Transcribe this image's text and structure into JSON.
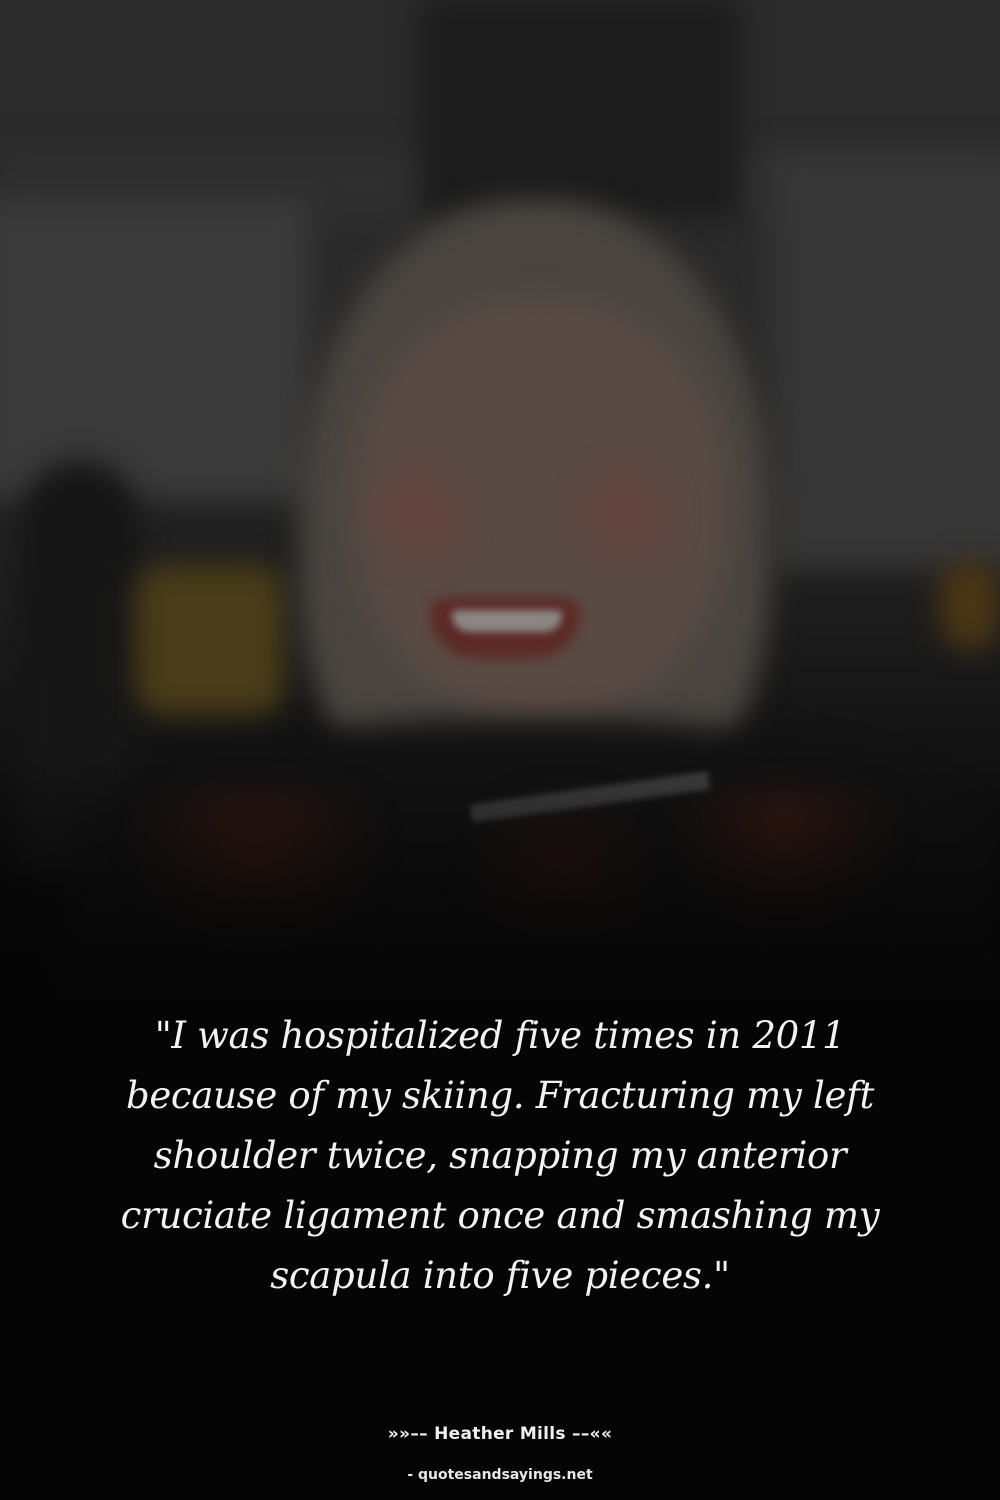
{
  "quote": {
    "text": "\"I was hospitalized five times in 2011 because of my skiing. Fracturing my left shoulder twice, snapping my anterior cruciate ligament once and smashing my scapula into five pieces.\"",
    "author": "»»–– Heather Mills ––««",
    "source": "- quotesandsayings.net"
  }
}
